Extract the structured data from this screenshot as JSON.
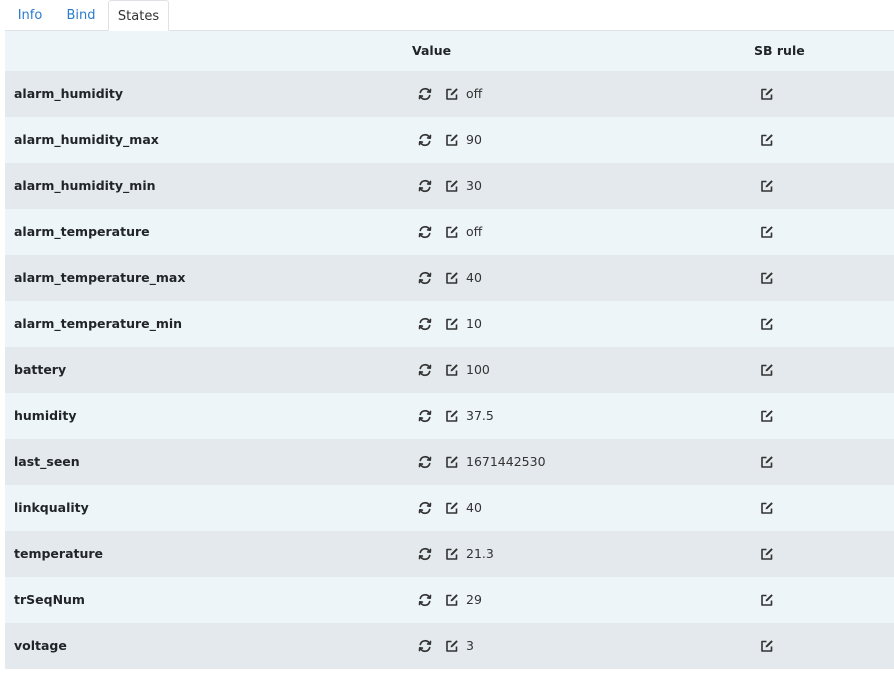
{
  "tabs": [
    {
      "label": "Info",
      "active": false
    },
    {
      "label": "Bind",
      "active": false
    },
    {
      "label": "States",
      "active": true
    }
  ],
  "table": {
    "headers": {
      "value": "Value",
      "sb_rule": "SB rule"
    },
    "rows": [
      {
        "name": "alarm_humidity",
        "value": "off"
      },
      {
        "name": "alarm_humidity_max",
        "value": "90"
      },
      {
        "name": "alarm_humidity_min",
        "value": "30"
      },
      {
        "name": "alarm_temperature",
        "value": "off"
      },
      {
        "name": "alarm_temperature_max",
        "value": "40"
      },
      {
        "name": "alarm_temperature_min",
        "value": "10"
      },
      {
        "name": "battery",
        "value": "100"
      },
      {
        "name": "humidity",
        "value": "37.5"
      },
      {
        "name": "last_seen",
        "value": "1671442530"
      },
      {
        "name": "linkquality",
        "value": "40"
      },
      {
        "name": "temperature",
        "value": "21.3"
      },
      {
        "name": "trSeqNum",
        "value": "29"
      },
      {
        "name": "voltage",
        "value": "3"
      }
    ]
  },
  "icons": {
    "refresh": "refresh-icon",
    "edit": "edit-icon"
  },
  "colors": {
    "link": "#2b7bce",
    "row_odd": "#e3e9ec",
    "row_even": "#eef5f9"
  }
}
